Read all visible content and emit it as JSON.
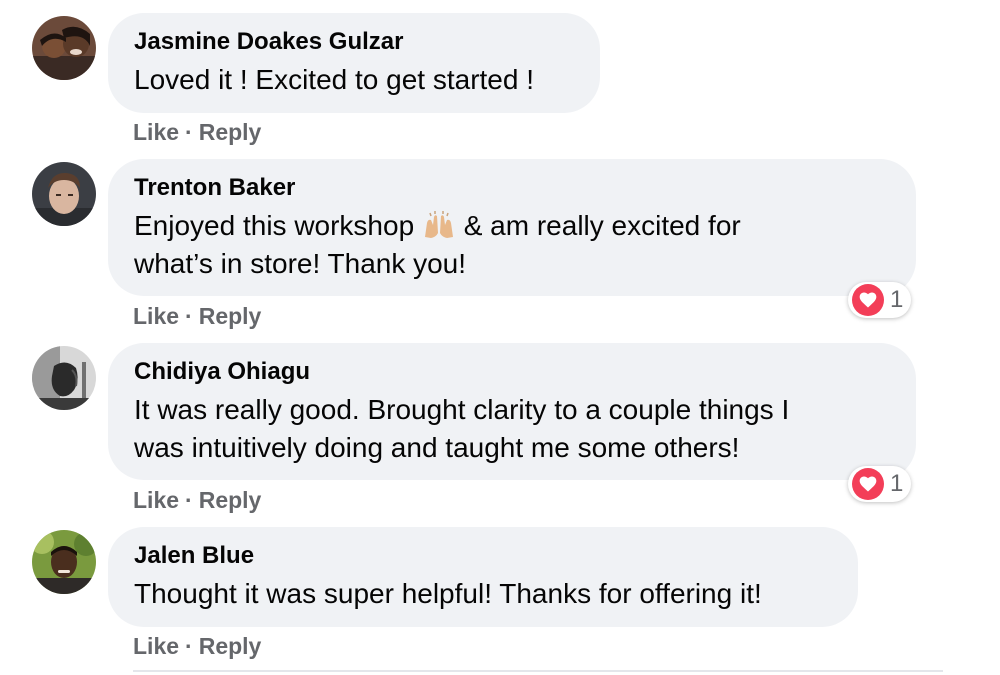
{
  "comments": [
    {
      "author": "Jasmine Doakes Gulzar",
      "text": "Loved it ! Excited to get started !",
      "like_label": "Like",
      "separator": "·",
      "reply_label": "Reply"
    },
    {
      "author": "Trenton Baker",
      "text_before_emoji": "Enjoyed this workshop ",
      "emoji": "raising-hands-emoji",
      "text_after_emoji": " & am really excited for\nwhat’s in store! Thank you!",
      "like_label": "Like",
      "separator": "·",
      "reply_label": "Reply",
      "reaction": {
        "icon": "heart-icon",
        "count": "1",
        "color": "#f33e58"
      }
    },
    {
      "author": "Chidiya Ohiagu",
      "text": "It was really good. Brought clarity to a couple things I\nwas intuitively doing and taught me some others!",
      "like_label": "Like",
      "separator": "·",
      "reply_label": "Reply",
      "reaction": {
        "icon": "heart-icon",
        "count": "1",
        "color": "#f33e58"
      }
    },
    {
      "author": "Jalen Blue",
      "text": "Thought it was super helpful! Thanks for offering it!",
      "like_label": "Like",
      "separator": "·",
      "reply_label": "Reply"
    }
  ],
  "colors": {
    "bubble_bg": "#f0f2f5",
    "action_text": "#65676b",
    "author_text": "#050505",
    "love_red": "#f33e58"
  }
}
